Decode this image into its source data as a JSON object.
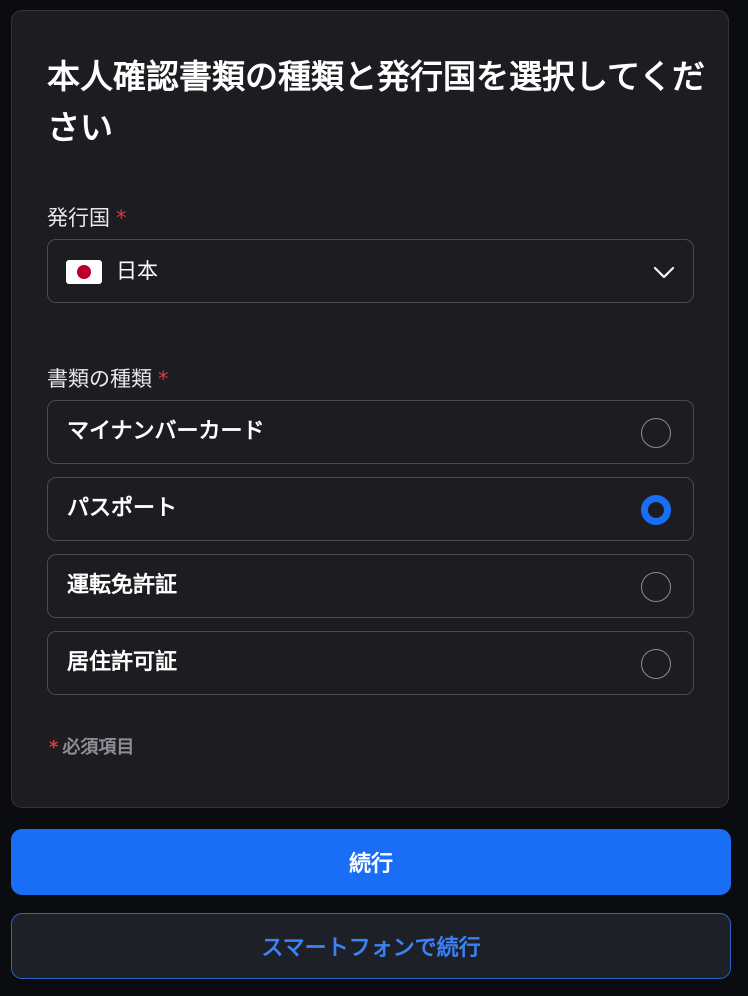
{
  "title": "本人確認書類の種類と発行国を選択してください",
  "country": {
    "label": "発行国",
    "required_mark": "*",
    "selected": "日本",
    "flag": "japan-flag"
  },
  "doc_type": {
    "label": "書類の種類",
    "required_mark": "*",
    "options": [
      {
        "label": "マイナンバーカード",
        "selected": false
      },
      {
        "label": "パスポート",
        "selected": true
      },
      {
        "label": "運転免許証",
        "selected": false
      },
      {
        "label": "居住許可証",
        "selected": false
      }
    ]
  },
  "required_note": {
    "mark": "*",
    "text": "必須項目"
  },
  "buttons": {
    "continue": "続行",
    "continue_on_phone": "スマートフォンで続行"
  },
  "colors": {
    "accent": "#1a6ef5",
    "required": "#e0383e",
    "card_bg": "#1c1c21",
    "page_bg": "#0b0c0f"
  }
}
